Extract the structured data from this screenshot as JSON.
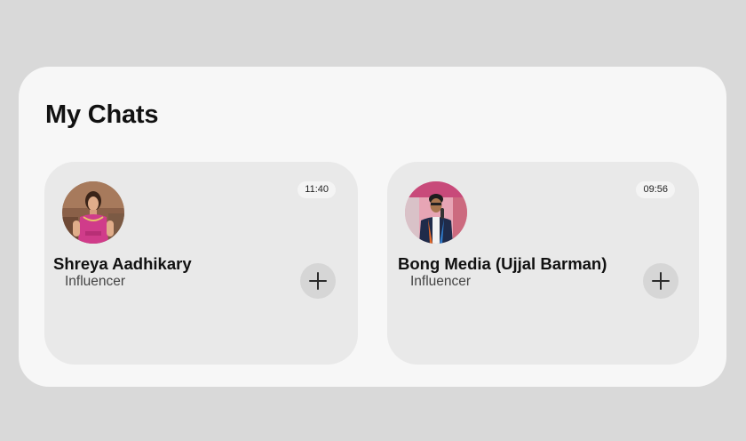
{
  "page": {
    "title": "My Chats"
  },
  "chats": [
    {
      "name": "Shreya Aadhikary",
      "role": "Influencer",
      "time": "11:40",
      "avatar_icon": "profile-photo"
    },
    {
      "name": "Bong Media (Ujjal Barman)",
      "role": "Influencer",
      "time": "09:56",
      "avatar_icon": "profile-photo"
    }
  ],
  "colors": {
    "background": "#d9d9d9",
    "panel": "#f7f7f7",
    "card": "#e9e9e9",
    "add_button": "#d6d6d6"
  }
}
